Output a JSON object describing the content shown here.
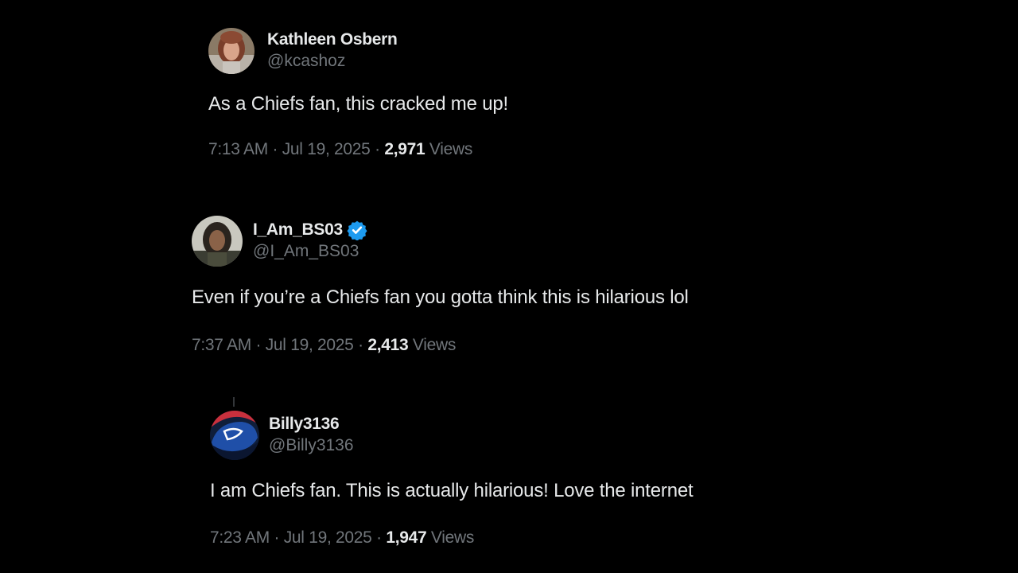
{
  "tweets": [
    {
      "display_name": "Kathleen Osbern",
      "handle": "@kcashoz",
      "verified": false,
      "avatar_icon": "profile-photo-woman",
      "text": "As a Chiefs fan, this cracked me up!",
      "time": "7:13 AM",
      "date": "Jul 19, 2025",
      "views_count": "2,971",
      "views_label": "Views"
    },
    {
      "display_name": "I_Am_BS03",
      "handle": "@I_Am_BS03",
      "verified": true,
      "verified_icon": "verified-badge-icon",
      "avatar_icon": "profile-photo-man",
      "text": "Even if you’re a Chiefs fan you gotta think this is hilarious lol",
      "time": "7:37 AM",
      "date": "Jul 19, 2025",
      "views_count": "2,413",
      "views_label": "Views"
    },
    {
      "display_name": "Billy3136",
      "handle": "@Billy3136",
      "verified": false,
      "avatar_icon": "profile-photo-bills-helmet",
      "text": "I am Chiefs fan. This is actually hilarious! Love the internet",
      "time": "7:23 AM",
      "date": "Jul 19, 2025",
      "views_count": "1,947",
      "views_label": "Views"
    }
  ],
  "separator": " · ",
  "colors": {
    "background": "#000000",
    "primary_text": "#e7e9ea",
    "secondary_text": "#71767b",
    "verified_blue": "#1d9bf0"
  }
}
